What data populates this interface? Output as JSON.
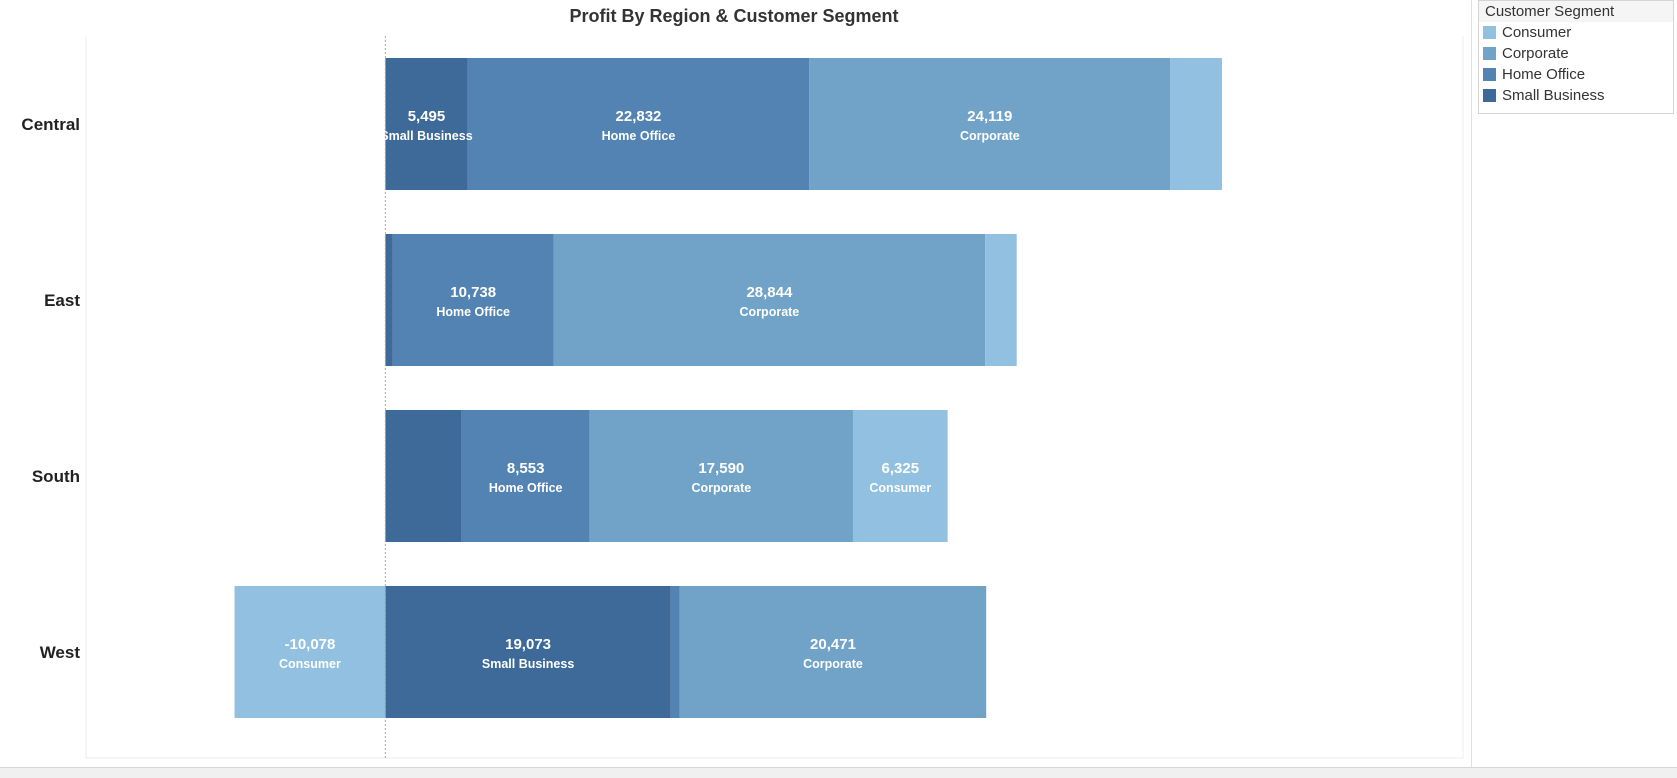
{
  "chart_data": {
    "type": "bar",
    "orientation": "horizontal",
    "stacked": true,
    "title": "Profit By Region & Customer Segment",
    "categories": [
      "Central",
      "East",
      "South",
      "West"
    ],
    "series": [
      {
        "name": "Small Business",
        "color": "#3e6a99",
        "values": [
          5495,
          500,
          5100,
          19073
        ]
      },
      {
        "name": "Home Office",
        "color": "#5283b3",
        "values": [
          22832,
          10738,
          8553,
          600
        ]
      },
      {
        "name": "Corporate",
        "color": "#71a3c9",
        "values": [
          24119,
          28844,
          17590,
          20471
        ]
      },
      {
        "name": "Consumer",
        "color": "#92c0e0",
        "values": [
          3450,
          2100,
          6325,
          -10078
        ]
      }
    ],
    "data_labels": [
      {
        "category": "Central",
        "series": "Small Business",
        "value_text": "5,495",
        "segment_text": "Small Business"
      },
      {
        "category": "Central",
        "series": "Home Office",
        "value_text": "22,832",
        "segment_text": "Home Office"
      },
      {
        "category": "Central",
        "series": "Corporate",
        "value_text": "24,119",
        "segment_text": "Corporate"
      },
      {
        "category": "East",
        "series": "Home Office",
        "value_text": "10,738",
        "segment_text": "Home Office"
      },
      {
        "category": "East",
        "series": "Corporate",
        "value_text": "28,844",
        "segment_text": "Corporate"
      },
      {
        "category": "South",
        "series": "Home Office",
        "value_text": "8,553",
        "segment_text": "Home Office"
      },
      {
        "category": "South",
        "series": "Corporate",
        "value_text": "17,590",
        "segment_text": "Corporate"
      },
      {
        "category": "South",
        "series": "Consumer",
        "value_text": "6,325",
        "segment_text": "Consumer"
      },
      {
        "category": "West",
        "series": "Consumer",
        "value_text": "-10,078",
        "segment_text": "Consumer"
      },
      {
        "category": "West",
        "series": "Small Business",
        "value_text": "19,073",
        "segment_text": "Small Business"
      },
      {
        "category": "West",
        "series": "Corporate",
        "value_text": "20,471",
        "segment_text": "Corporate"
      }
    ],
    "xlim": [
      -20000,
      72000
    ],
    "grid": false,
    "zero_line": true,
    "legend_position": "top-right"
  },
  "legend": {
    "title": "Customer Segment",
    "items": [
      {
        "label": "Consumer",
        "color": "#92c0e0"
      },
      {
        "label": "Corporate",
        "color": "#71a3c9"
      },
      {
        "label": "Home Office",
        "color": "#5283b3"
      },
      {
        "label": "Small Business",
        "color": "#3e6a99"
      }
    ]
  }
}
